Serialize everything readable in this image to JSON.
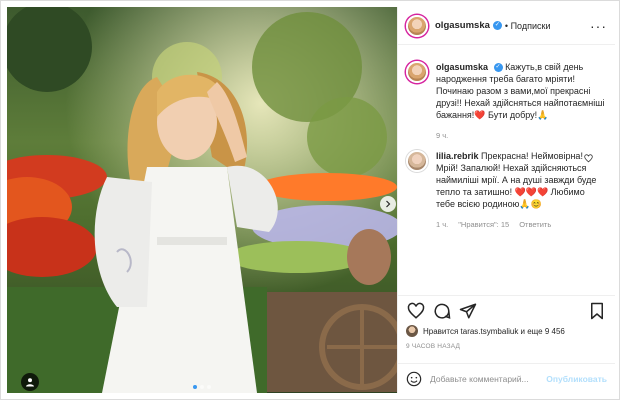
{
  "post": {
    "username": "olgasumska",
    "follow_label": "• Подписки",
    "more_label": "···"
  },
  "caption": {
    "username": "olgasumska",
    "text": "Кажуть,в свій день народження треба багато мріяти! Починаю разом з вами,мої прекрасні друзі!! Нехай здійсняться найпотаємніші бажання!❤️ Бути добру!🙏",
    "time": "9 ч."
  },
  "comments": [
    {
      "username": "lilia.rebrik",
      "text": "Прекрасна! Неймовірна! Мрій! Запалюй! Нехай здійсняються наймиліші мрії. А на душі завжди буде тепло та затишно! ❤️❤️❤️ Любимо тебе всією родиною🙏😊",
      "time": "1 ч.",
      "likes": "\"Нравится\": 15",
      "reply": "Ответить"
    }
  ],
  "likes_text": "Нравится taras.tsymbaliuk и еще 9 456",
  "timestamp": "9 ЧАСОВ НАЗАД",
  "add_comment": {
    "placeholder": "Добавьте комментарий...",
    "publish": "Опубликовать"
  },
  "colors": {
    "accent": "#3897f0",
    "like_red": "#ed4956",
    "muted": "#8e8e8e",
    "publish_disabled": "#b2dffc"
  },
  "icons": [
    "heart-icon",
    "comment-icon",
    "share-icon",
    "bookmark-icon",
    "smile-icon",
    "verified-icon",
    "user-tag-icon",
    "chevron-right-icon"
  ]
}
